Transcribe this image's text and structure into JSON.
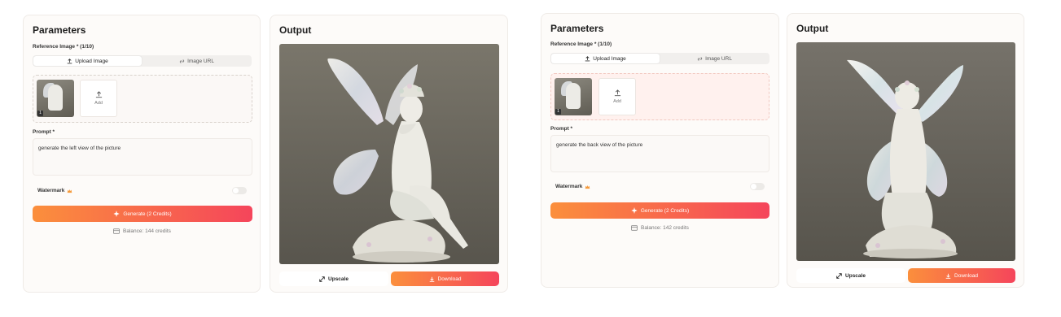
{
  "left": {
    "params_title": "Parameters",
    "ref_label": "Reference Image * (1/10)",
    "tab_upload": "Upload Image",
    "tab_url": "Image URL",
    "thumb_index": "1",
    "add_label": "Add",
    "prompt_label": "Prompt *",
    "prompt_value": "generate the left view of the picture",
    "watermark_label": "Watermark",
    "generate_label": "Generate (2 Credits)",
    "balance": "Balance: 144 credits",
    "output_title": "Output",
    "upscale_label": "Upscale",
    "download_label": "Download"
  },
  "right": {
    "params_title": "Parameters",
    "ref_label": "Reference Image * (1/10)",
    "tab_upload": "Upload Image",
    "tab_url": "Image URL",
    "thumb_index": "1",
    "add_label": "Add",
    "prompt_label": "Prompt *",
    "prompt_value": "generate the back view of the picture",
    "watermark_label": "Watermark",
    "generate_label": "Generate (2 Credits)",
    "balance": "Balance: 142 credits",
    "output_title": "Output",
    "upscale_label": "Upscale",
    "download_label": "Download"
  },
  "colors": {
    "accent_start": "#fb8f3c",
    "accent_end": "#f5455b",
    "photo_bg": "#6e6a60"
  }
}
